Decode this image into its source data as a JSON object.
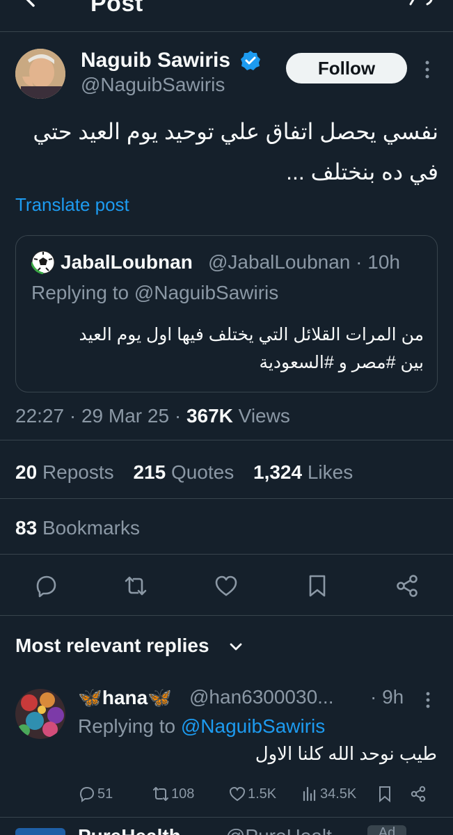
{
  "header": {
    "title": "Post"
  },
  "post": {
    "author_name": "Naguib Sawiris",
    "author_handle": "@NaguibSawiris",
    "follow_label": "Follow",
    "text_line1": "نفسي يحصل اتفاق علي توحيد يوم العيد حتي",
    "text_line2": "في ده بنختلف ...",
    "translate_label": "Translate post",
    "quote": {
      "name": "JabalLoubnan",
      "meta": "@JabalLoubnan · 10h",
      "replying": "Replying to @NaguibSawiris",
      "text_line1": "من المرات القلائل التي يختلف فيها اول يوم العيد",
      "text_line2": "بين #مصر و #السعودية"
    },
    "time": "22:27",
    "date": "29 Mar 25",
    "views_count": "367K",
    "views_label": "Views",
    "reposts_count": "20",
    "reposts_label": "Reposts",
    "quotes_count": "215",
    "quotes_label": "Quotes",
    "likes_count": "1,324",
    "likes_label": "Likes",
    "bookmarks_count": "83",
    "bookmarks_label": "Bookmarks"
  },
  "replies_section": {
    "title": "Most relevant replies"
  },
  "reply": {
    "name": "🦋hana🦋",
    "handle": "@han6300030...",
    "time": "· 9h",
    "replying_prefix": "Replying to",
    "replying_mention": "@NaguibSawiris",
    "text": "طيب نوحد الله كلنا الاول",
    "replies": "51",
    "reposts": "108",
    "likes": "1.5K",
    "views": "34.5K"
  },
  "next_reply": {
    "name": "PureHealth",
    "handle": "@PureHealt",
    "ad": "Ad"
  },
  "colors": {
    "background": "#15202b",
    "accent": "#1d9bf0",
    "muted": "#8b98a5",
    "divider": "#38444d"
  }
}
